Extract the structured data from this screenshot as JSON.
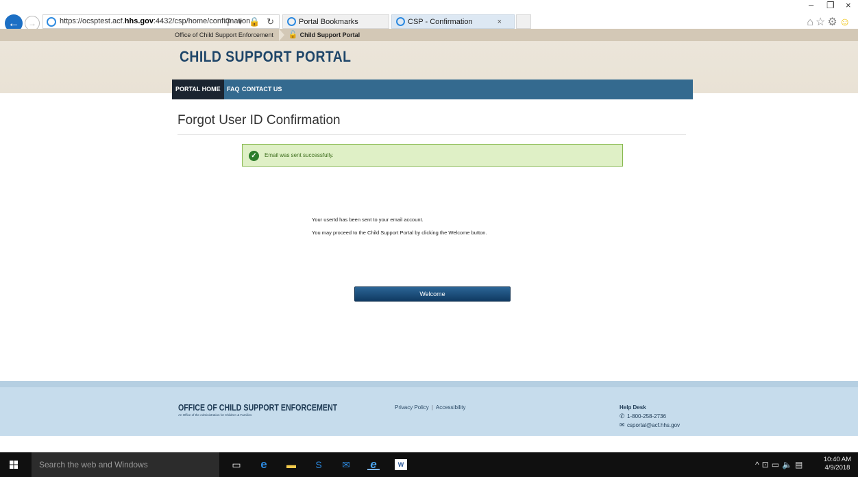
{
  "browser": {
    "url_prefix": "https://ocsptest.acf.",
    "url_domain": "hhs.gov",
    "url_suffix": ":4432/csp/home/confirmation",
    "address_icons": "⚲ ▾ 🔒 ↻",
    "tabs": [
      {
        "label": "Portal Bookmarks"
      },
      {
        "label": "CSP - Confirmation",
        "close": "×"
      }
    ],
    "win_minimize": "–",
    "win_restore": "❐",
    "win_close": "×"
  },
  "header": {
    "breadcrumb_parent": "Office of Child Support Enforcement",
    "breadcrumb_current": "Child Support Portal",
    "logo": "CHILD SUPPORT PORTAL",
    "nav": [
      {
        "label": "PORTAL HOME"
      },
      {
        "label": "FAQ"
      },
      {
        "label": "CONTACT US"
      }
    ]
  },
  "main": {
    "title": "Forgot User ID Confirmation",
    "alert_message": "Email was sent successfully.",
    "info_line1": "Your userId has been sent to your email account.",
    "info_line2": "You may proceed to the Child Support Portal by clicking the Welcome button.",
    "welcome_button": "Welcome"
  },
  "footer": {
    "brand": "OFFICE OF CHILD SUPPORT ENFORCEMENT",
    "brand_sub": "An Office of the Administration for Children & Families",
    "privacy": "Privacy Policy",
    "separator": "|",
    "accessibility": "Accessibility",
    "help_title": "Help Desk",
    "phone": "1-800-258-2736",
    "email": "csportal@acf.hhs.gov"
  },
  "taskbar": {
    "search_placeholder": "Search the web and Windows",
    "time": "10:40 AM",
    "date": "4/9/2018"
  }
}
